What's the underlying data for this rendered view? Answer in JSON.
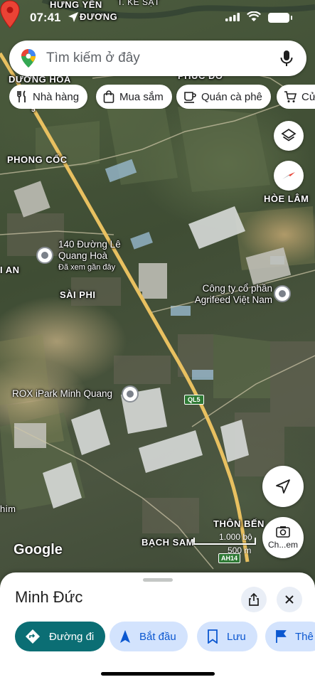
{
  "status_bar": {
    "time": "07:41"
  },
  "search": {
    "placeholder": "Tìm kiếm ở đây"
  },
  "chips": [
    {
      "label": "Nhà hàng",
      "icon": "fork-knife-icon"
    },
    {
      "label": "Mua sắm",
      "icon": "shopping-bag-icon"
    },
    {
      "label": "Quán cà phê",
      "icon": "coffee-cup-icon"
    },
    {
      "label": "Cửa",
      "icon": "cart-icon"
    }
  ],
  "map": {
    "labels": {
      "hung_yen": "HƯNG YÊN",
      "duong": "ĐƯƠNG",
      "ke_sat": "T. KẺ SẶT",
      "duong_hoa": "DƯƠNG HOA",
      "phuc_do": "PHÚC ĐÔ",
      "phong_coc": "PHONG CỐC",
      "hoe_lam": "HÒE LÂM",
      "an": "I AN",
      "sai_phi": "SÀI PHI",
      "thon_ben": "THÔN BẾN",
      "bach_sam": "BẠCH SAM",
      "him": "him",
      "road_5": "5"
    },
    "pois": [
      {
        "name": "140 Đường Lê Quang Hoà",
        "sub": "Đã xem gần đây"
      },
      {
        "name": "Công ty cổ phần Agrifeed Việt Nam"
      },
      {
        "name": "ROX iPark Minh Quang"
      }
    ],
    "road_shield": "QL5",
    "asian_highway": "AH14",
    "scale": {
      "imperial": "1.000 bộ",
      "metric": "500 m"
    },
    "logo": "Google",
    "ch_button_label": "Ch...em"
  },
  "sheet": {
    "title": "Minh Đức",
    "actions": [
      {
        "label": "Đường đi",
        "primary": true
      },
      {
        "label": "Bắt đầu"
      },
      {
        "label": "Lưu"
      },
      {
        "label": "Thê"
      }
    ]
  },
  "colors": {
    "primary_action": "#0b6e74",
    "secondary_action": "#d3e3fd",
    "pin_red": "#ea4335",
    "highway": "#e8c060"
  }
}
